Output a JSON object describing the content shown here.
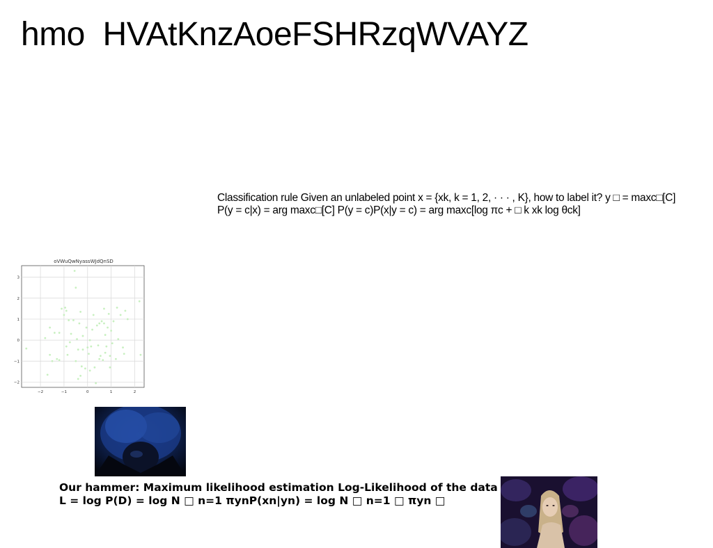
{
  "slide": {
    "title": "hmo  HVAtKnzAoeFSHRzqWVAYZ",
    "classification_text": "Classification rule Given an unlabeled point x = {xk, k = 1, 2, · · · , K}, how to label it? y □ = maxc□[C] P(y = c|x) = arg maxc□[C] P(y = c)P(x|y = c) = arg maxc[log πc + □ k xk log θck]",
    "mle_text": "Our hammer: Maximum likelihood estimation Log-Likelihood of the data L = log P(D) = log N □ n=1 πynP(xn|yn) = log N □ n=1 □ πyn □"
  },
  "chart_data": {
    "type": "scatter",
    "title": "oVWuQwNyassWJdQnSD",
    "xlim": [
      -2.8,
      2.4
    ],
    "ylim": [
      -2.25,
      3.55
    ],
    "xticks": [
      "-2",
      "-1",
      "0",
      "1",
      "2"
    ],
    "yticks": [
      "3",
      "2",
      "1",
      "0",
      "-1",
      "-2"
    ],
    "grid": true,
    "marker_color": "#c8f0c0",
    "points": [
      [
        -2.6,
        -0.4
      ],
      [
        -1.8,
        0.1
      ],
      [
        -1.7,
        -1.65
      ],
      [
        -1.6,
        0.6
      ],
      [
        -1.6,
        -0.7
      ],
      [
        -1.5,
        -1.0
      ],
      [
        -1.4,
        0.35
      ],
      [
        -1.3,
        -0.9
      ],
      [
        -1.2,
        -0.95
      ],
      [
        -1.2,
        0.35
      ],
      [
        -1.1,
        1.5
      ],
      [
        -1.0,
        1.2
      ],
      [
        -0.95,
        1.55
      ],
      [
        -0.9,
        -0.3
      ],
      [
        -0.9,
        1.4
      ],
      [
        -0.85,
        -0.7
      ],
      [
        -0.8,
        0.95
      ],
      [
        -0.75,
        -0.1
      ],
      [
        -0.7,
        0.3
      ],
      [
        -0.6,
        0.95
      ],
      [
        -0.55,
        3.3
      ],
      [
        -0.5,
        -1.0
      ],
      [
        -0.5,
        2.5
      ],
      [
        -0.45,
        0.05
      ],
      [
        -0.4,
        -1.85
      ],
      [
        -0.4,
        -0.45
      ],
      [
        -0.35,
        0.8
      ],
      [
        -0.3,
        -1.7
      ],
      [
        -0.3,
        1.35
      ],
      [
        -0.25,
        -1.25
      ],
      [
        -0.2,
        -0.45
      ],
      [
        -0.2,
        0.2
      ],
      [
        -0.1,
        -1.35
      ],
      [
        -0.05,
        0.6
      ],
      [
        0.0,
        -0.35
      ],
      [
        0.05,
        -0.65
      ],
      [
        0.1,
        -1.45
      ],
      [
        0.1,
        0.0
      ],
      [
        0.15,
        -0.3
      ],
      [
        0.2,
        0.5
      ],
      [
        0.25,
        1.2
      ],
      [
        0.3,
        -1.3
      ],
      [
        0.35,
        -2.05
      ],
      [
        0.4,
        0.7
      ],
      [
        0.45,
        -0.25
      ],
      [
        0.5,
        0.8
      ],
      [
        0.5,
        -0.9
      ],
      [
        0.55,
        -0.75
      ],
      [
        0.6,
        0.9
      ],
      [
        0.65,
        -0.95
      ],
      [
        0.7,
        0.8
      ],
      [
        0.7,
        1.5
      ],
      [
        0.75,
        0.25
      ],
      [
        0.75,
        -0.6
      ],
      [
        0.8,
        -0.3
      ],
      [
        0.85,
        0.6
      ],
      [
        0.9,
        1.25
      ],
      [
        0.95,
        -0.75
      ],
      [
        0.95,
        -1.3
      ],
      [
        1.0,
        0.45
      ],
      [
        1.05,
        -0.15
      ],
      [
        1.1,
        0.9
      ],
      [
        1.2,
        -0.9
      ],
      [
        1.25,
        1.55
      ],
      [
        1.3,
        0.05
      ],
      [
        1.4,
        1.2
      ],
      [
        1.5,
        -0.35
      ],
      [
        1.55,
        -0.65
      ],
      [
        1.6,
        1.4
      ],
      [
        1.7,
        1.0
      ],
      [
        2.2,
        1.85
      ],
      [
        2.25,
        -0.7
      ]
    ]
  }
}
